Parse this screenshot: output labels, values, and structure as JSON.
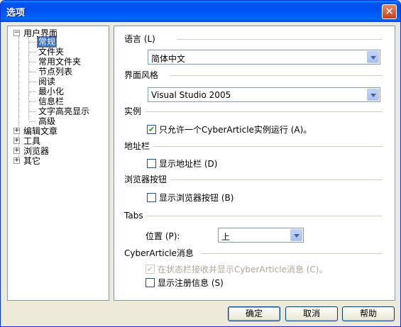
{
  "window": {
    "title": "选项"
  },
  "tree": {
    "items": [
      {
        "label": "用户界面",
        "expander": "−"
      },
      {
        "label": "常规"
      },
      {
        "label": "文件夹"
      },
      {
        "label": "常用文件夹"
      },
      {
        "label": "节点列表"
      },
      {
        "label": "阅读"
      },
      {
        "label": "最小化"
      },
      {
        "label": "信息栏"
      },
      {
        "label": "文字高亮显示"
      },
      {
        "label": "高级"
      },
      {
        "label": "编辑文章",
        "expander": "+"
      },
      {
        "label": "工具",
        "expander": "+"
      },
      {
        "label": "浏览器",
        "expander": "+"
      },
      {
        "label": "其它",
        "expander": "+"
      }
    ],
    "selected": "常规"
  },
  "settings": {
    "language": {
      "label": "语言 (L)",
      "value": "简体中文"
    },
    "style": {
      "label": "界面风格",
      "value": "Visual Studio 2005"
    },
    "instance": {
      "label": "实例",
      "checkbox_label": "只允许一个CyberArticle实例运行 (A)。",
      "checked": true
    },
    "addressbar": {
      "label": "地址栏",
      "checkbox_label": "显示地址栏 (D)",
      "checked": false
    },
    "browser_buttons": {
      "label": "浏览器按钮",
      "checkbox_label": "显示浏览器按钮 (B)",
      "checked": false
    },
    "tabs": {
      "label": "Tabs",
      "position_label": "位置 (P):",
      "position_value": "上"
    },
    "messages": {
      "label": "CyberArticle消息",
      "statusbar_label": "在状态栏接收并显示CyberArticle消息 (C)。",
      "statusbar_checked": true,
      "statusbar_disabled": true,
      "register_label": "显示注册信息 (S)",
      "register_checked": false
    }
  },
  "buttons": {
    "ok": "确定",
    "cancel": "取消",
    "help": "帮助"
  },
  "icons": {
    "check": "checkmark-icon",
    "close": "close-icon",
    "dropdown": "chevron-down-icon"
  }
}
